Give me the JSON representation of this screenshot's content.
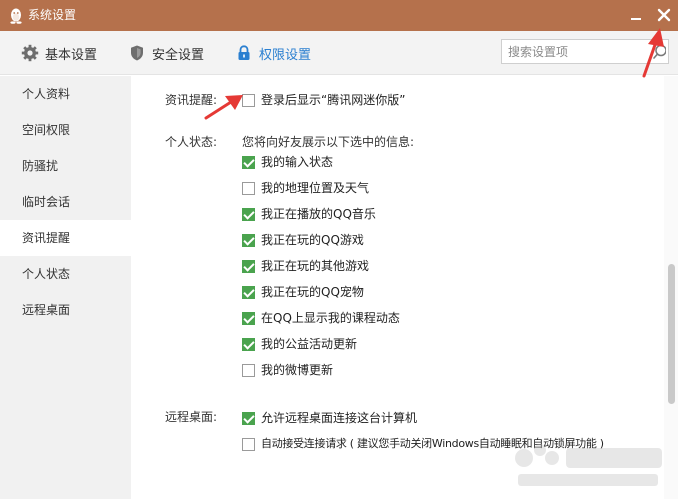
{
  "window": {
    "title": "系统设置",
    "colors": {
      "titlebar": "#b5714c",
      "accent": "#2a7fd0",
      "checkbox_on": "#4aa34e",
      "arrow": "#e53935"
    }
  },
  "toolbar": {
    "tabs": [
      {
        "label": "基本设置",
        "icon": "gear-icon"
      },
      {
        "label": "安全设置",
        "icon": "shield-icon"
      },
      {
        "label": "权限设置",
        "icon": "lock-icon",
        "active": true
      }
    ],
    "search": {
      "placeholder": "搜索设置项",
      "value": ""
    }
  },
  "sidebar": {
    "items": [
      {
        "label": "个人资料"
      },
      {
        "label": "空间权限"
      },
      {
        "label": "防骚扰"
      },
      {
        "label": "临时会话"
      },
      {
        "label": "资讯提醒",
        "active": true
      },
      {
        "label": "个人状态"
      },
      {
        "label": "远程桌面"
      }
    ]
  },
  "content": {
    "news": {
      "label": "资讯提醒:",
      "option": {
        "text": "登录后显示“腾讯网迷你版”",
        "checked": false
      }
    },
    "status": {
      "label": "个人状态:",
      "intro": "您将向好友展示以下选中的信息:",
      "options": [
        {
          "text": "我的输入状态",
          "checked": true
        },
        {
          "text": "我的地理位置及天气",
          "checked": false
        },
        {
          "text": "我正在播放的QQ音乐",
          "checked": true
        },
        {
          "text": "我正在玩的QQ游戏",
          "checked": true
        },
        {
          "text": "我正在玩的其他游戏",
          "checked": true
        },
        {
          "text": "我正在玩的QQ宠物",
          "checked": true
        },
        {
          "text": "在QQ上显示我的课程动态",
          "checked": true
        },
        {
          "text": "我的公益活动更新",
          "checked": true
        },
        {
          "text": "我的微博更新",
          "checked": false
        }
      ]
    },
    "remote": {
      "label": "远程桌面:",
      "options": [
        {
          "text": "允许远程桌面连接这台计算机",
          "checked": true
        },
        {
          "text": "自动接受连接请求 ( 建议您手动关闭Windows自动睡眠和自动锁屏功能 )",
          "checked": false
        }
      ]
    }
  },
  "scrollbar": {
    "position": 0.45
  }
}
